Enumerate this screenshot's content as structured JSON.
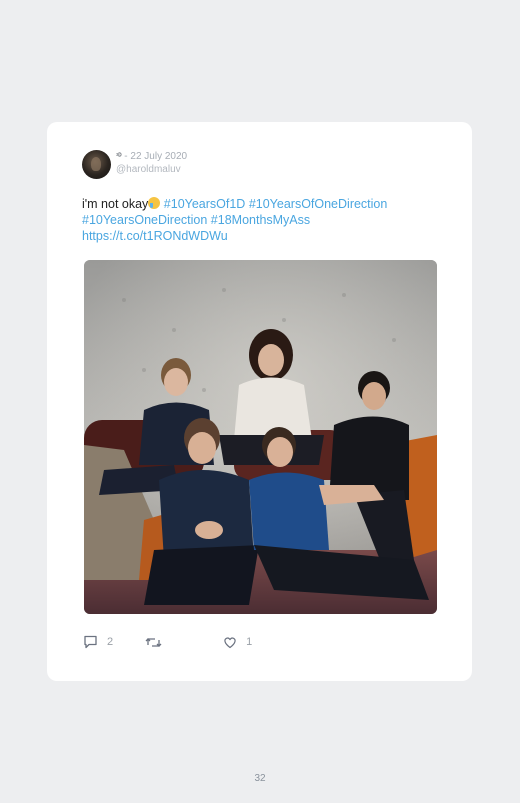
{
  "tweet": {
    "display_name": "¹ᴰ",
    "date": "22 July 2020",
    "separator": " - ",
    "handle": "@haroldmaluv",
    "text_plain": "i'm not okay",
    "hashtags": [
      "#10YearsOf1D",
      "#10YearsOfOneDirection",
      "#10YearsOneDirection",
      "#18MonthsMyAss"
    ],
    "link": "https://t.co/t1RONdWDWu"
  },
  "actions": {
    "reply_count": "2",
    "retweet_count": "",
    "like_count": "1"
  },
  "page_number": "32",
  "icons": [
    "avatar",
    "crying-emoji",
    "reply-icon",
    "retweet-icon",
    "like-icon"
  ],
  "colors": {
    "hashtag": "#4aa6e0",
    "page_bg": "#edeef0",
    "card_bg": "#ffffff"
  }
}
